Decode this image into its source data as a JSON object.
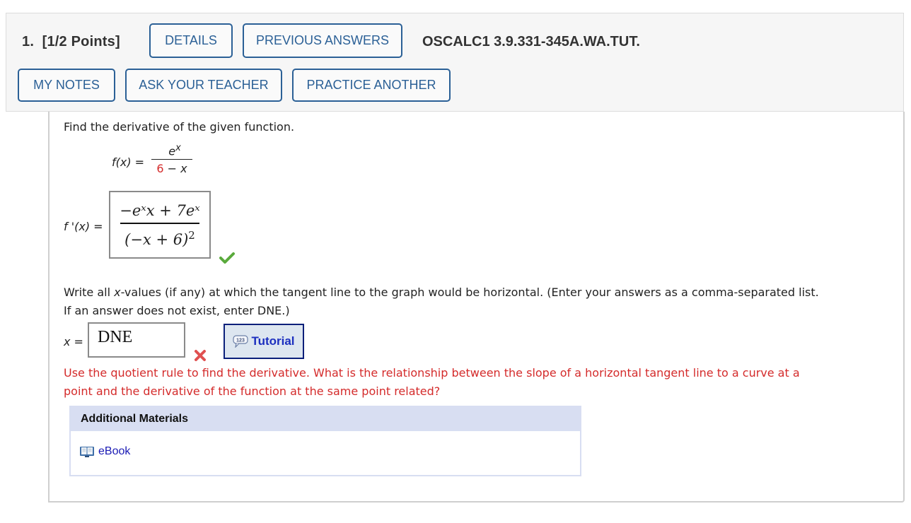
{
  "header": {
    "question_number": "1.",
    "points": "[1/2 Points]",
    "buttons": {
      "details": "DETAILS",
      "previous_answers": "PREVIOUS ANSWERS",
      "my_notes": "MY NOTES",
      "ask_teacher": "ASK YOUR TEACHER",
      "practice_another": "PRACTICE ANOTHER"
    },
    "question_code": "OSCALC1 3.9.331-345A.WA.TUT."
  },
  "part1": {
    "prompt": "Find the derivative of the given function.",
    "function_label": "f(x) =",
    "numerator": "e",
    "numerator_exp": "x",
    "denominator_const": "6",
    "denominator_rest": "− x",
    "derivative_label": "f '(x) =",
    "answer_numerator": "−eˣx + 7eˣ",
    "answer_denominator": "(−x + 6)",
    "answer_denominator_exp": "2",
    "status": "correct"
  },
  "part2": {
    "prompt_a": "Write all ",
    "prompt_var": "x",
    "prompt_b": "-values (if any) at which the tangent line to the graph would be horizontal. (Enter your answers as a comma-separated list.",
    "prompt_line2": "If an answer does not exist, enter DNE.)",
    "input_label": "x =",
    "input_value": "DNE",
    "status": "incorrect",
    "tutorial_label": "Tutorial",
    "tutorial_icon_text": "123",
    "feedback_line1": "Use the quotient rule to find the derivative. What is the relationship between the slope of a horizontal tangent line to a curve at a",
    "feedback_line2": "point and the derivative of the function at the same point related?"
  },
  "additional_materials": {
    "title": "Additional Materials",
    "ebook_label": "eBook"
  },
  "colors": {
    "button_border": "#2b6096",
    "feedback_red": "#d42b2b",
    "check_green": "#5aaa3c",
    "link_blue": "#1a1ab4"
  }
}
